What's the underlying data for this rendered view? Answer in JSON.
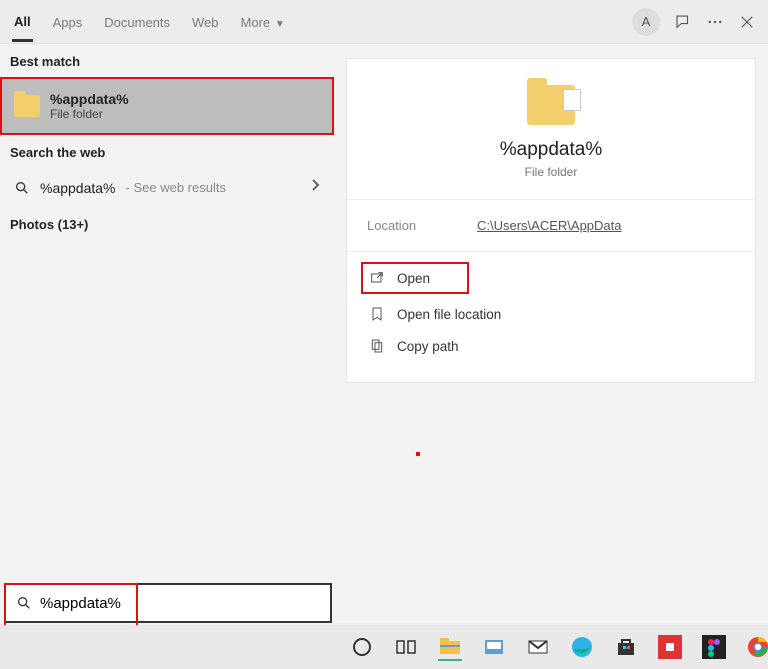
{
  "tabs": {
    "all": "All",
    "apps": "Apps",
    "documents": "Documents",
    "web": "Web",
    "more": "More"
  },
  "header": {
    "avatar_letter": "A"
  },
  "left": {
    "best_match_label": "Best match",
    "best_title": "%appdata%",
    "best_sub": "File folder",
    "search_web_label": "Search the web",
    "web_query": "%appdata%",
    "web_hint": "- See web results",
    "photos_label": "Photos (13+)"
  },
  "preview": {
    "title": "%appdata%",
    "sub": "File folder",
    "location_label": "Location",
    "location_value": "C:\\Users\\ACER\\AppData",
    "actions": {
      "open": "Open",
      "open_loc": "Open file location",
      "copy_path": "Copy path"
    }
  },
  "search": {
    "value": "%appdata%"
  }
}
